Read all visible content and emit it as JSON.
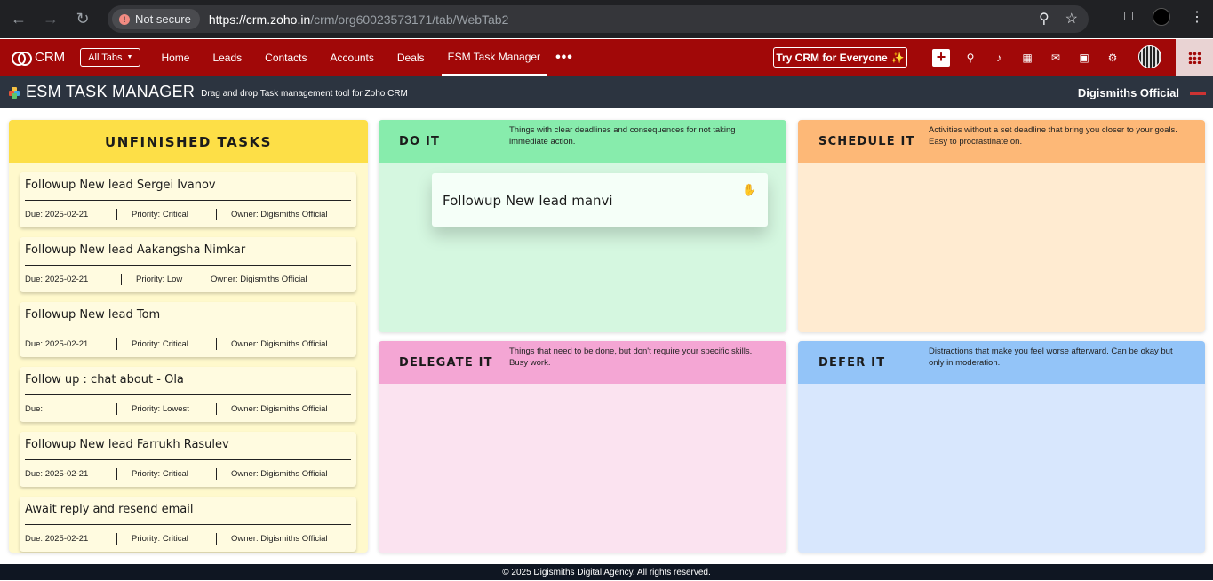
{
  "browser": {
    "security_label": "Not secure",
    "url_host": "https://crm.zoho.in",
    "url_path": "/crm/org60023573171/tab/WebTab2"
  },
  "crm": {
    "brand": "CRM",
    "all_tabs": "All Tabs",
    "tabs": [
      "Home",
      "Leads",
      "Contacts",
      "Accounts",
      "Deals",
      "ESM Task Manager"
    ],
    "active_tab": "ESM Task Manager",
    "more": "•••",
    "try_button": "Try CRM for Everyone"
  },
  "app": {
    "title": "ESM TASK MANAGER",
    "subtitle": "Drag and drop Task management tool for Zoho CRM",
    "org": "Digismiths Official"
  },
  "unfinished": {
    "title": "UNFINISHED TASKS",
    "tasks": [
      {
        "title": "Followup New lead Sergei Ivanov",
        "due": "Due: 2025-02-21",
        "priority": "Priority: Critical",
        "owner": "Owner: Digismiths Official"
      },
      {
        "title": "Followup New lead Aakangsha Nimkar",
        "due": "Due: 2025-02-21",
        "priority": "Priority: Low",
        "owner": "Owner: Digismiths Official"
      },
      {
        "title": "Followup New lead Tom",
        "due": "Due: 2025-02-21",
        "priority": "Priority: Critical",
        "owner": "Owner: Digismiths Official"
      },
      {
        "title": "Follow up : chat about - Ola",
        "due": "Due:",
        "priority": "Priority: Lowest",
        "owner": "Owner: Digismiths Official"
      },
      {
        "title": "Followup New lead Farrukh Rasulev",
        "due": "Due: 2025-02-21",
        "priority": "Priority: Critical",
        "owner": "Owner: Digismiths Official"
      },
      {
        "title": "Await reply and resend email",
        "due": "Due: 2025-02-21",
        "priority": "Priority: Critical",
        "owner": "Owner: Digismiths Official"
      }
    ]
  },
  "quadrants": {
    "do_it": {
      "title": "DO IT",
      "desc": "Things with clear deadlines and consequences for not taking immediate action."
    },
    "schedule_it": {
      "title": "SCHEDULE IT",
      "desc": "Activities without a set deadline that bring you closer to your goals. Easy to procrastinate on."
    },
    "delegate_it": {
      "title": "DELEGATE IT",
      "desc": "Things that need to be done, but don't require your specific skills. Busy work."
    },
    "defer_it": {
      "title": "DEFER IT",
      "desc": "Distractions that make you feel worse afterward. Can be okay but only in moderation."
    }
  },
  "dragging": {
    "title": "Followup New lead manvi"
  },
  "footer": {
    "text": "© 2025 Digismiths Digital Agency. All rights reserved."
  },
  "colors": {
    "crm_bar": "#a10808",
    "app_header": "#2c3440",
    "unfinished_head": "#fddf47",
    "do_it": "#87ecac",
    "schedule_it": "#fdb877",
    "delegate_it": "#f4a6d4",
    "defer_it": "#93c4f8"
  }
}
